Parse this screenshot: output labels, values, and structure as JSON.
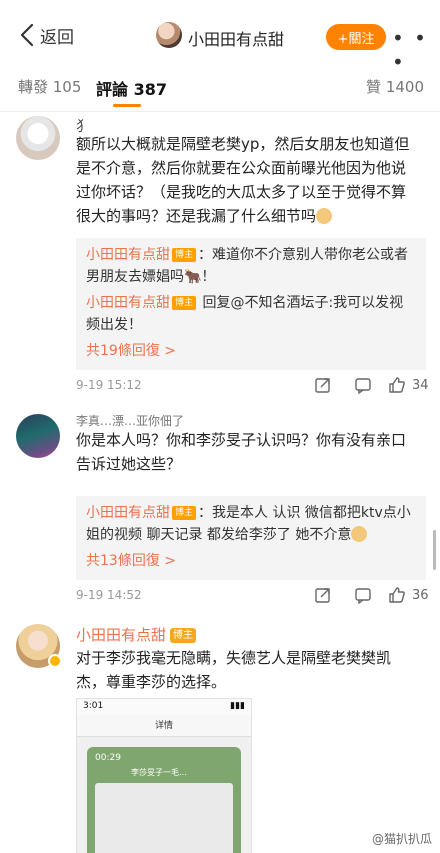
{
  "header": {
    "back_label": "返回",
    "title": "小田田有点甜",
    "follow_label": "+關注",
    "more_label": "• • •"
  },
  "tabs": {
    "reposts": "轉發 105",
    "comments": "評論 387",
    "likes": "贊 1400"
  },
  "comments": [
    {
      "name": "犭",
      "text": "额所以大概就是隔壁老樊yp，然后女朋友也知道但是不介意，然后你就要在公众面前曝光他因为他说过你坏话？（是我吃的大瓜太多了以至于觉得不算很大的事吗？还是我漏了什么细节吗",
      "replies": [
        {
          "name": "小田田有点甜",
          "tag": "博主",
          "text": "：难道你不介意别人带你老公或者男朋友去嫖娼吗🐂！"
        },
        {
          "name": "小田田有点甜",
          "tag": "博主",
          "text": " 回复@不知名酒坛子:我可以发视频出发！"
        }
      ],
      "more_replies": "共19條回復 >",
      "time": "9-19 15:12",
      "likes": "34"
    },
    {
      "name": "李真…漂…亚你佃了",
      "text": "你是本人吗？你和李莎旻子认识吗？你有没有亲口告诉过她这些？",
      "replies": [
        {
          "name": "小田田有点甜",
          "tag": "博主",
          "text": "：我是本人 认识 微信都把ktv点小姐的视频 聊天记录 都发给李莎了 她不介意"
        }
      ],
      "more_replies": "共13條回復 >",
      "time": "9-19 14:52",
      "likes": "36"
    },
    {
      "name": "小田田有点甜",
      "tag": "博主",
      "text": "对于李莎我毫无隐瞒，失德艺人是隔壁老樊樊凯杰，尊重李莎的选择。",
      "screenshot": {
        "status_time": "3:01",
        "page_title": "详情",
        "inner_time": "00:29",
        "inner_title": "李莎旻子一毛…"
      }
    }
  ],
  "watermark": "@猫扒扒瓜"
}
